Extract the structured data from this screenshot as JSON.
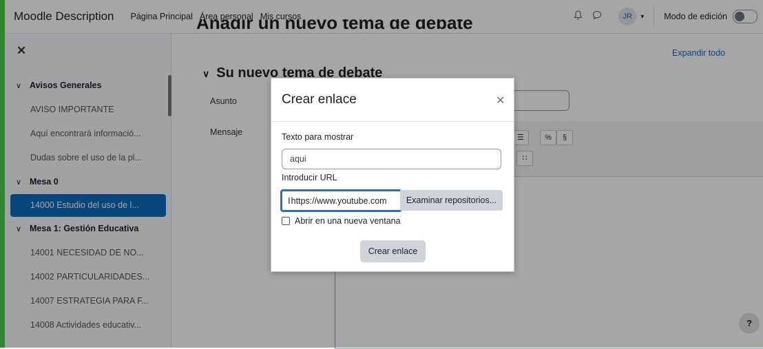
{
  "navbar": {
    "brand": "Moodle Description",
    "links": [
      "Página Principal",
      "Área personal",
      "Mis cursos"
    ],
    "notifications_icon": "bell-icon",
    "messages_icon": "chat-icon",
    "user_initials": "JR",
    "edit_mode_label": "Modo de edición"
  },
  "drawer": {
    "close_icon": "close-icon",
    "items": [
      {
        "label": "Avisos Generales",
        "type": "section"
      },
      {
        "label": "AVISO IMPORTANTE",
        "type": "item"
      },
      {
        "label": "Aquí encontrará informació...",
        "type": "item"
      },
      {
        "label": "Dudas sobre el uso de la pl...",
        "type": "item"
      },
      {
        "label": "Mesa 0",
        "type": "section"
      },
      {
        "label": "14000 Estudio del uso de l...",
        "type": "active"
      },
      {
        "label": "Mesa 1: Gestión Educativa",
        "type": "section"
      },
      {
        "label": "14001 NECESIDAD DE NO...",
        "type": "item"
      },
      {
        "label": "14002 PARTICULARIDADES...",
        "type": "item"
      },
      {
        "label": "14007 ESTRATEGIA PARA F...",
        "type": "item"
      },
      {
        "label": "14008 Actividades educativ...",
        "type": "item"
      }
    ]
  },
  "main": {
    "page_heading": "Añadir un nuevo tema de debate",
    "expand_all": "Expandir todo",
    "section_title": "Su nuevo tema de debate",
    "subject_label": "Asunto",
    "message_label": "Mensaje",
    "help_button": "?"
  },
  "modal": {
    "title": "Crear enlace",
    "close_icon": "close-icon",
    "text_label": "Texto para mostrar",
    "text_value": "aqui",
    "url_label": "Introducir URL",
    "url_value": "https://www.youtube.com",
    "browse_label": "Examinar repositorios...",
    "new_window_label": "Abrir en una nueva ventana",
    "create_label": "Crear enlace"
  },
  "colors": {
    "accent": "#0f6cbf",
    "focus_border": "#2d6fb2",
    "left_edge": "#4cd04c"
  }
}
